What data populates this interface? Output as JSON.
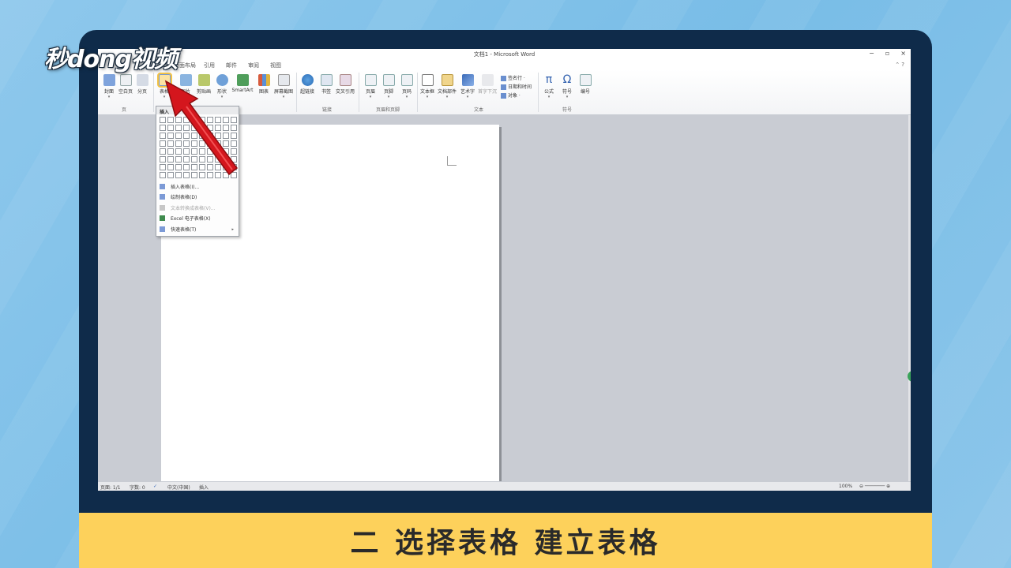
{
  "branding": {
    "logo_text": "秒dong视频"
  },
  "caption": "二  选择表格 建立表格",
  "window": {
    "title": "文档1 - Microsoft Word",
    "controls": [
      "−",
      "▫",
      "×"
    ],
    "help": "⌃ ?"
  },
  "tabs": [
    "页面布局",
    "引用",
    "邮件",
    "审阅",
    "视图"
  ],
  "ribbon": {
    "page_group": {
      "label": "页",
      "buttons": [
        "封面",
        "空白页",
        "分页"
      ]
    },
    "table_button": {
      "label": "表格"
    },
    "illustrations": {
      "buttons": [
        "图片",
        "剪贴画",
        "形状",
        "SmartArt",
        "图表",
        "屏幕截图"
      ]
    },
    "links_group": {
      "label": "链接",
      "buttons": [
        "超链接",
        "书签",
        "交叉引用"
      ]
    },
    "header_group": {
      "label": "页眉和页脚",
      "buttons": [
        "页眉",
        "页脚",
        "页码"
      ]
    },
    "text_group": {
      "label": "文本",
      "buttons": [
        "文本框",
        "文档部件",
        "艺术字",
        "首字下沉"
      ],
      "small": [
        "签名行 ·",
        "日期和时间",
        "对象 ·"
      ]
    },
    "symbols_group": {
      "label": "符号",
      "buttons": [
        "公式",
        "符号",
        "编号"
      ],
      "glyphs": [
        "π",
        "Ω"
      ]
    }
  },
  "dropdown": {
    "header": "插入",
    "grid_rows": 8,
    "grid_cols": 10,
    "items": [
      {
        "label": "插入表格(I)...",
        "disabled": false
      },
      {
        "label": "绘制表格(D)",
        "disabled": false
      },
      {
        "label": "文本转换成表格(V)...",
        "disabled": true
      },
      {
        "label": "Excel 电子表格(X)",
        "disabled": false
      },
      {
        "label": "快速表格(T)",
        "disabled": false,
        "submenu": true
      }
    ]
  },
  "statusbar": {
    "page": "页面: 1/1",
    "words": "字数: 0",
    "lang": "中文(中国)",
    "mode": "插入",
    "zoom": "100%"
  },
  "colors": {
    "accent_red": "#d4161d",
    "caption_bg": "#fdd15b",
    "frame": "#0f2b4a"
  }
}
